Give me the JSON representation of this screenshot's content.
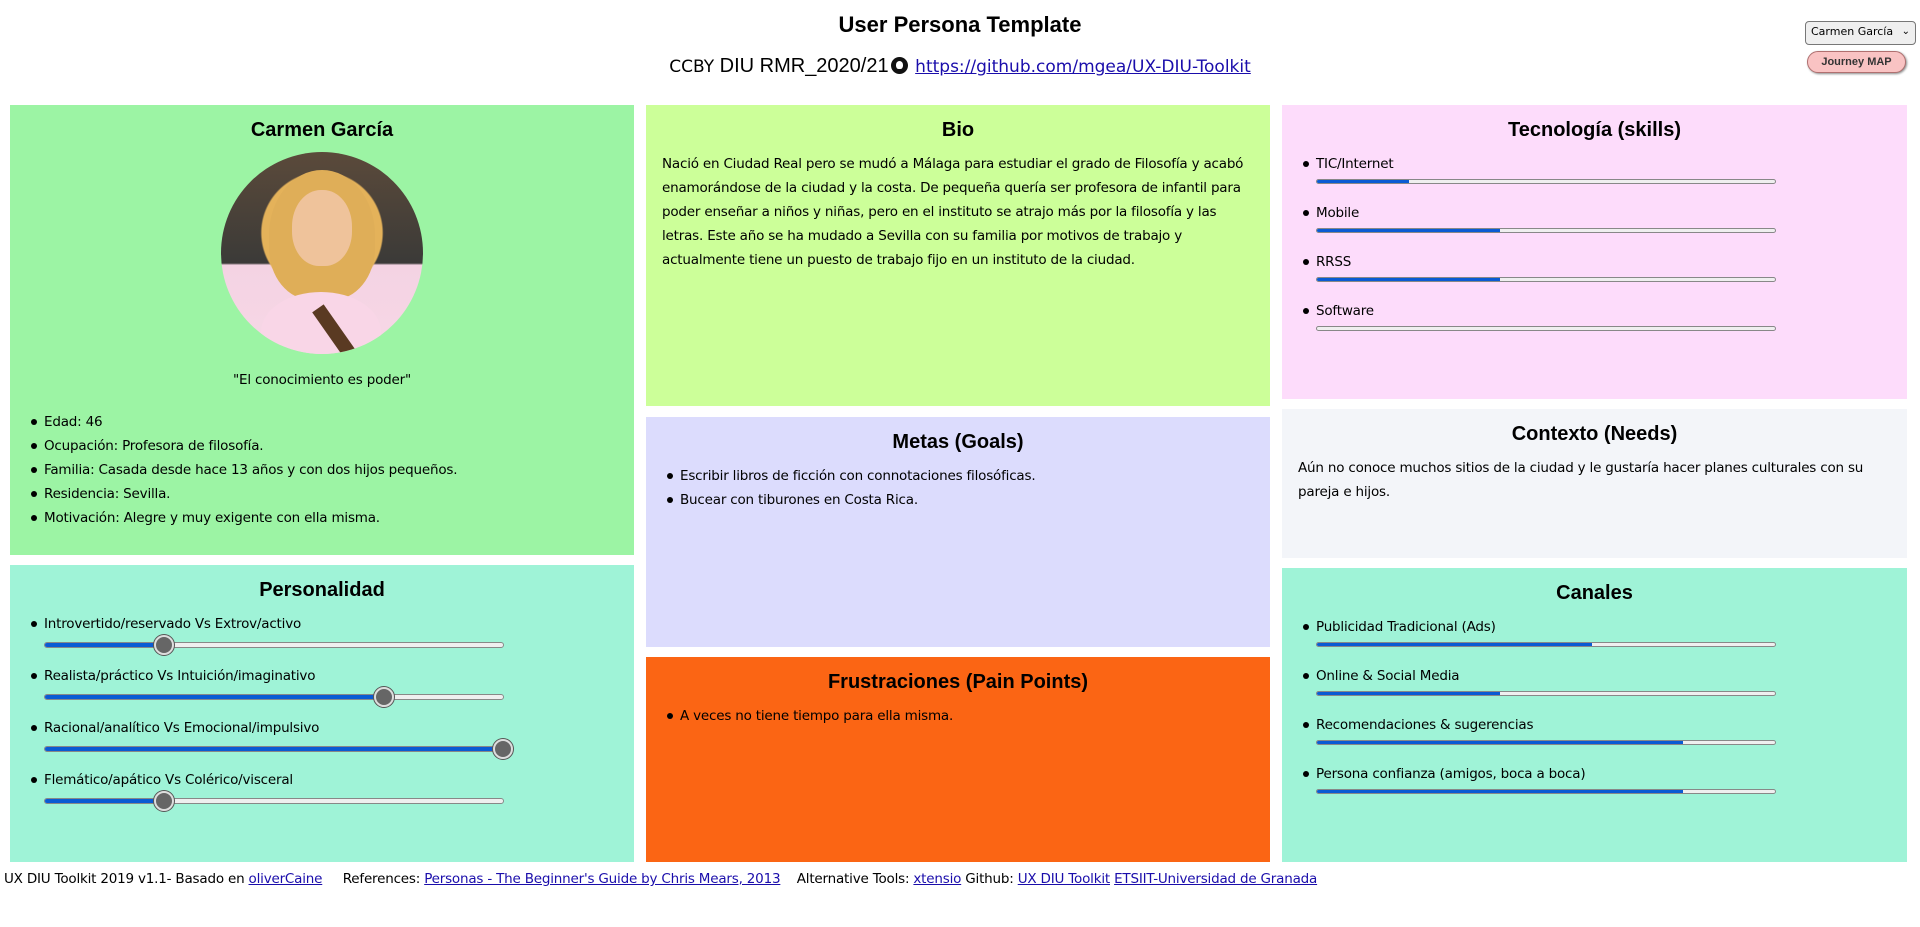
{
  "header": {
    "title": "User Persona Template",
    "license": "CCBY",
    "course": "DIU RMR_2020/21",
    "repo_link": "https://github.com/mgea/UX-DIU-Toolkit",
    "persona_select": "Carmen García",
    "journey_button": "Journey MAP"
  },
  "profile": {
    "name": "Carmen García",
    "quote": "\"El conocimiento es poder\"",
    "details": [
      "Edad: 46",
      "Ocupación: Profesora de filosofía.",
      "Familia: Casada desde hace 13 años y con dos hijos pequeños.",
      "Residencia: Sevilla.",
      "Motivación: Alegre y muy exigente con ella misma."
    ]
  },
  "bio": {
    "title": "Bio",
    "text": "Nació en Ciudad Real pero se mudó a Málaga para estudiar el grado de Filosofía y acabó enamorándose de la ciudad y la costa. De pequeña quería ser profesora de infantil para poder enseñar a niños y niñas, pero en el instituto se atrajo más por la filosofía y las letras. Este año se ha mudado a Sevilla con su familia por motivos de trabajo y actualmente tiene un puesto de trabajo fijo en un instituto de la ciudad."
  },
  "technology": {
    "title": "Tecnología (skills)",
    "skills": [
      {
        "label": "TIC/Internet",
        "level": 0.2
      },
      {
        "label": "Mobile",
        "level": 0.4
      },
      {
        "label": "RRSS",
        "level": 0.4
      },
      {
        "label": "Software",
        "level": 0.0
      }
    ]
  },
  "personality": {
    "title": "Personalidad",
    "traits": [
      {
        "label": "Introvertido/reservado Vs Extrov/activo",
        "value": 0.26
      },
      {
        "label": "Realista/práctico Vs Intuición/imaginativo",
        "value": 0.74
      },
      {
        "label": "Racional/analítico Vs Emocional/impulsivo",
        "value": 1.0
      },
      {
        "label": "Flemático/apático Vs Colérico/visceral",
        "value": 0.26
      }
    ]
  },
  "goals": {
    "title": "Metas (Goals)",
    "items": [
      "Escribir libros de ficción con connotaciones filosóficas.",
      "Bucear con tiburones en Costa Rica."
    ]
  },
  "context": {
    "title": "Contexto (Needs)",
    "text": "Aún no conoce muchos sitios de la ciudad y le gustaría hacer planes culturales con su pareja e hijos."
  },
  "frustrations": {
    "title": "Frustraciones (Pain Points)",
    "items": [
      "A veces no tiene tiempo para ella misma."
    ]
  },
  "channels": {
    "title": "Canales",
    "items": [
      {
        "label": "Publicidad Tradicional (Ads)",
        "level": 0.6
      },
      {
        "label": "Online & Social Media",
        "level": 0.4
      },
      {
        "label": "Recomendaciones & sugerencias",
        "level": 0.8
      },
      {
        "label": "Persona confianza (amigos, boca a boca)",
        "level": 0.8
      }
    ]
  },
  "footer": {
    "prefix": "UX DIU Toolkit 2019 v1.1- Basado en",
    "based_link": "oliverCaine",
    "references_label": "References:",
    "references_link": "Personas - The Beginner's Guide by Chris Mears, 2013",
    "alt_tools_label": "Alternative Tools:",
    "alt_tools_link": "xtensio",
    "github_label": "Github:",
    "github_link": "UX DIU Toolkit",
    "univ_link": "ETSIIT-Universidad de Granada"
  }
}
